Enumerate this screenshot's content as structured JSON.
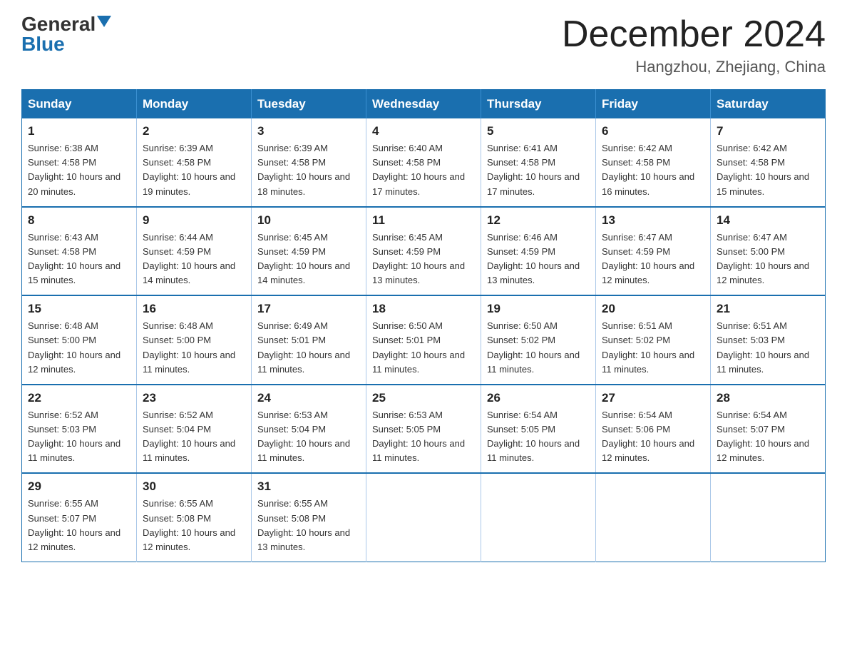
{
  "header": {
    "logo_general": "General",
    "logo_blue": "Blue",
    "month_title": "December 2024",
    "location": "Hangzhou, Zhejiang, China"
  },
  "weekdays": [
    "Sunday",
    "Monday",
    "Tuesday",
    "Wednesday",
    "Thursday",
    "Friday",
    "Saturday"
  ],
  "weeks": [
    [
      {
        "day": "1",
        "sunrise": "6:38 AM",
        "sunset": "4:58 PM",
        "daylight": "10 hours and 20 minutes."
      },
      {
        "day": "2",
        "sunrise": "6:39 AM",
        "sunset": "4:58 PM",
        "daylight": "10 hours and 19 minutes."
      },
      {
        "day": "3",
        "sunrise": "6:39 AM",
        "sunset": "4:58 PM",
        "daylight": "10 hours and 18 minutes."
      },
      {
        "day": "4",
        "sunrise": "6:40 AM",
        "sunset": "4:58 PM",
        "daylight": "10 hours and 17 minutes."
      },
      {
        "day": "5",
        "sunrise": "6:41 AM",
        "sunset": "4:58 PM",
        "daylight": "10 hours and 17 minutes."
      },
      {
        "day": "6",
        "sunrise": "6:42 AM",
        "sunset": "4:58 PM",
        "daylight": "10 hours and 16 minutes."
      },
      {
        "day": "7",
        "sunrise": "6:42 AM",
        "sunset": "4:58 PM",
        "daylight": "10 hours and 15 minutes."
      }
    ],
    [
      {
        "day": "8",
        "sunrise": "6:43 AM",
        "sunset": "4:58 PM",
        "daylight": "10 hours and 15 minutes."
      },
      {
        "day": "9",
        "sunrise": "6:44 AM",
        "sunset": "4:59 PM",
        "daylight": "10 hours and 14 minutes."
      },
      {
        "day": "10",
        "sunrise": "6:45 AM",
        "sunset": "4:59 PM",
        "daylight": "10 hours and 14 minutes."
      },
      {
        "day": "11",
        "sunrise": "6:45 AM",
        "sunset": "4:59 PM",
        "daylight": "10 hours and 13 minutes."
      },
      {
        "day": "12",
        "sunrise": "6:46 AM",
        "sunset": "4:59 PM",
        "daylight": "10 hours and 13 minutes."
      },
      {
        "day": "13",
        "sunrise": "6:47 AM",
        "sunset": "4:59 PM",
        "daylight": "10 hours and 12 minutes."
      },
      {
        "day": "14",
        "sunrise": "6:47 AM",
        "sunset": "5:00 PM",
        "daylight": "10 hours and 12 minutes."
      }
    ],
    [
      {
        "day": "15",
        "sunrise": "6:48 AM",
        "sunset": "5:00 PM",
        "daylight": "10 hours and 12 minutes."
      },
      {
        "day": "16",
        "sunrise": "6:48 AM",
        "sunset": "5:00 PM",
        "daylight": "10 hours and 11 minutes."
      },
      {
        "day": "17",
        "sunrise": "6:49 AM",
        "sunset": "5:01 PM",
        "daylight": "10 hours and 11 minutes."
      },
      {
        "day": "18",
        "sunrise": "6:50 AM",
        "sunset": "5:01 PM",
        "daylight": "10 hours and 11 minutes."
      },
      {
        "day": "19",
        "sunrise": "6:50 AM",
        "sunset": "5:02 PM",
        "daylight": "10 hours and 11 minutes."
      },
      {
        "day": "20",
        "sunrise": "6:51 AM",
        "sunset": "5:02 PM",
        "daylight": "10 hours and 11 minutes."
      },
      {
        "day": "21",
        "sunrise": "6:51 AM",
        "sunset": "5:03 PM",
        "daylight": "10 hours and 11 minutes."
      }
    ],
    [
      {
        "day": "22",
        "sunrise": "6:52 AM",
        "sunset": "5:03 PM",
        "daylight": "10 hours and 11 minutes."
      },
      {
        "day": "23",
        "sunrise": "6:52 AM",
        "sunset": "5:04 PM",
        "daylight": "10 hours and 11 minutes."
      },
      {
        "day": "24",
        "sunrise": "6:53 AM",
        "sunset": "5:04 PM",
        "daylight": "10 hours and 11 minutes."
      },
      {
        "day": "25",
        "sunrise": "6:53 AM",
        "sunset": "5:05 PM",
        "daylight": "10 hours and 11 minutes."
      },
      {
        "day": "26",
        "sunrise": "6:54 AM",
        "sunset": "5:05 PM",
        "daylight": "10 hours and 11 minutes."
      },
      {
        "day": "27",
        "sunrise": "6:54 AM",
        "sunset": "5:06 PM",
        "daylight": "10 hours and 12 minutes."
      },
      {
        "day": "28",
        "sunrise": "6:54 AM",
        "sunset": "5:07 PM",
        "daylight": "10 hours and 12 minutes."
      }
    ],
    [
      {
        "day": "29",
        "sunrise": "6:55 AM",
        "sunset": "5:07 PM",
        "daylight": "10 hours and 12 minutes."
      },
      {
        "day": "30",
        "sunrise": "6:55 AM",
        "sunset": "5:08 PM",
        "daylight": "10 hours and 12 minutes."
      },
      {
        "day": "31",
        "sunrise": "6:55 AM",
        "sunset": "5:08 PM",
        "daylight": "10 hours and 13 minutes."
      },
      null,
      null,
      null,
      null
    ]
  ]
}
